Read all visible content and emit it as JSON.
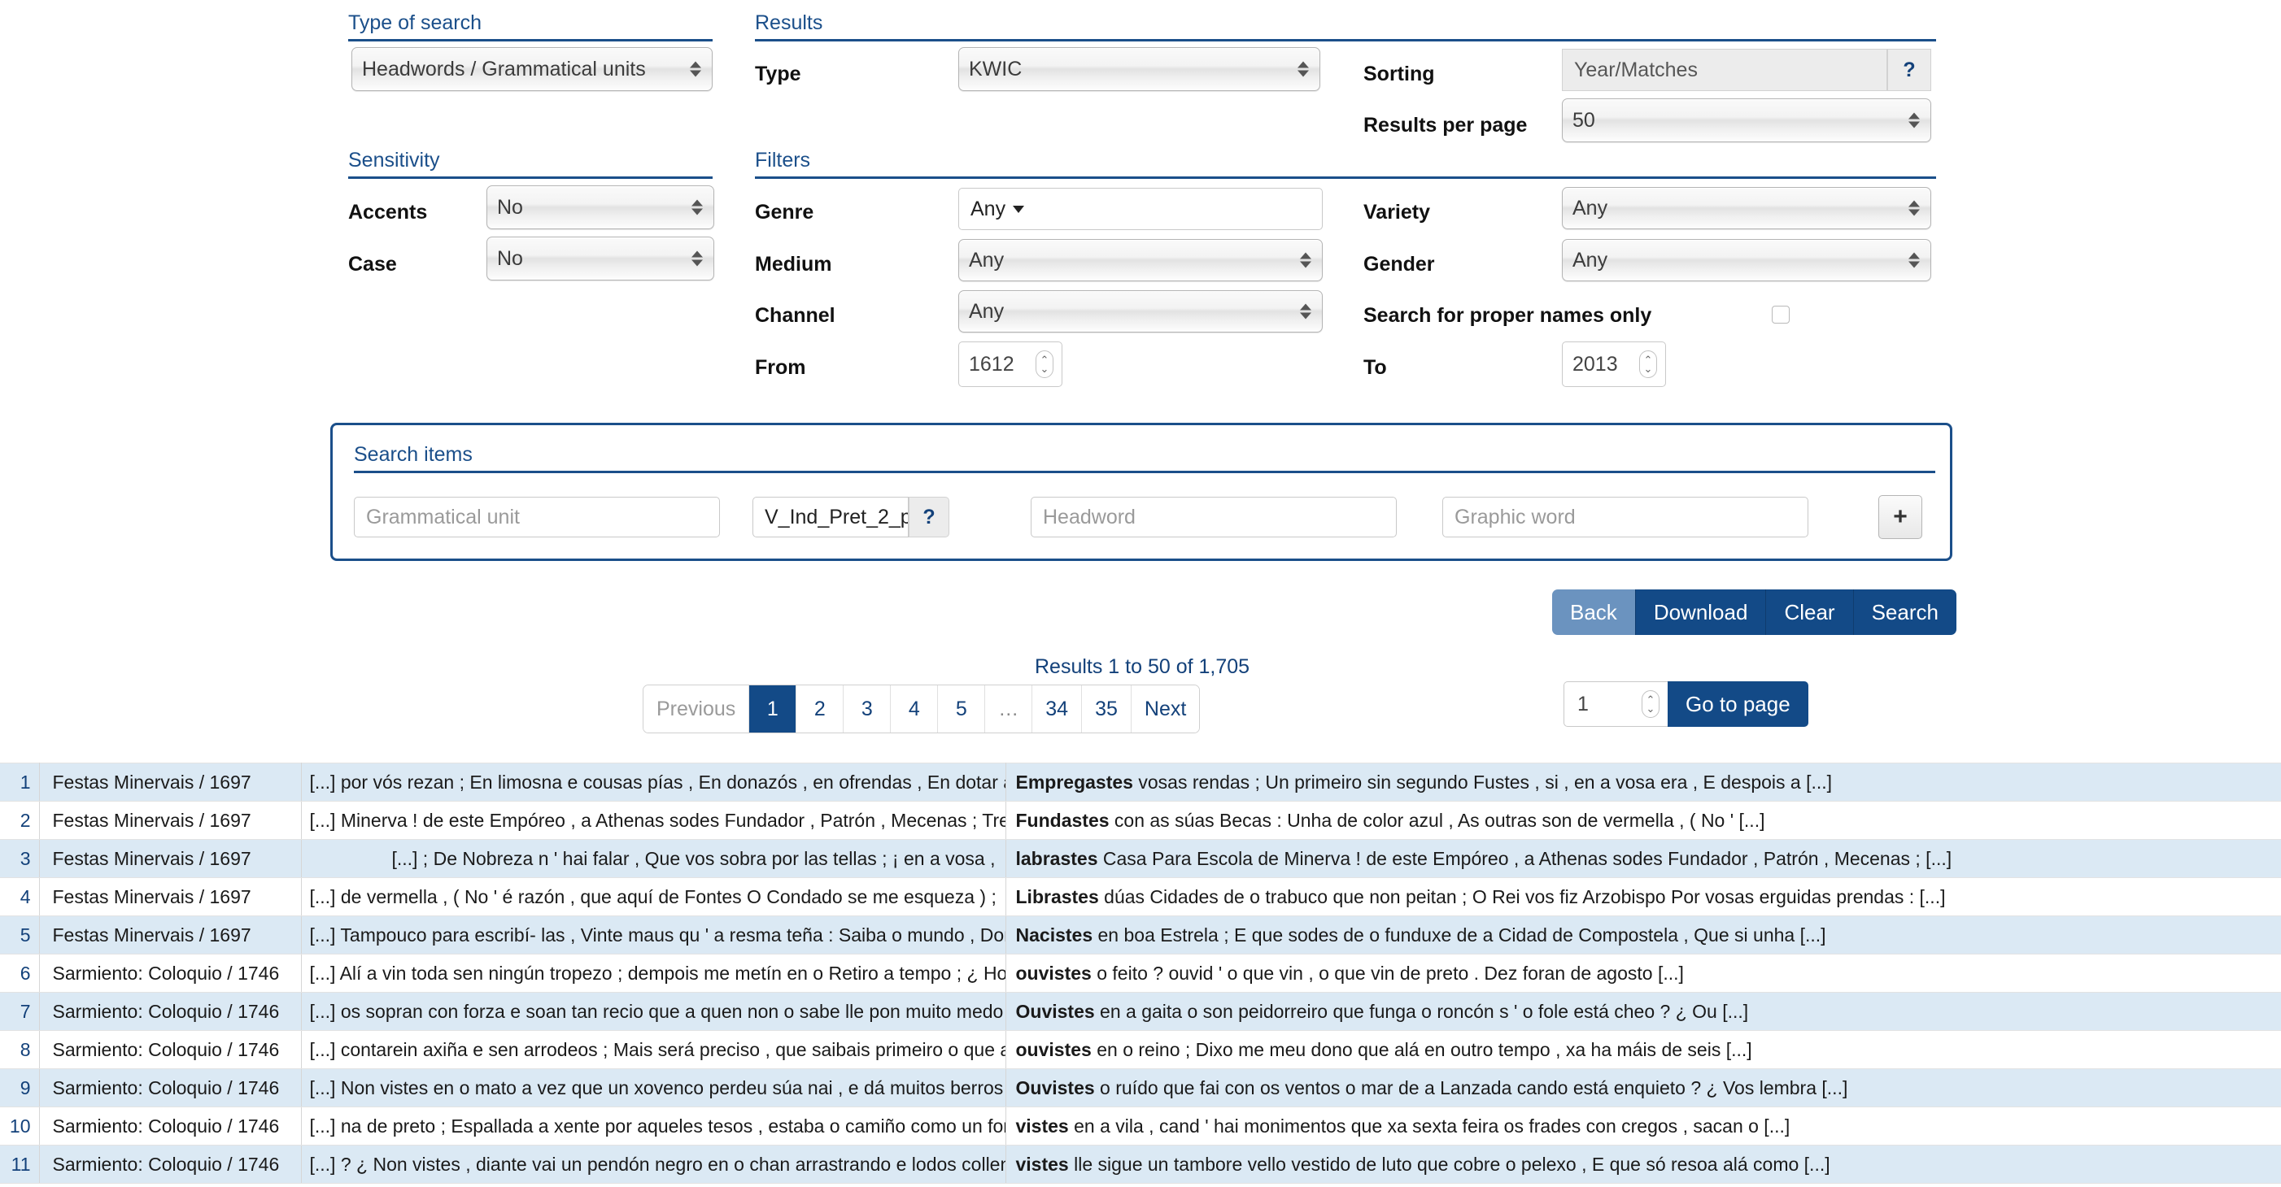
{
  "sections": {
    "type_of_search": "Type of search",
    "results": "Results",
    "sensitivity": "Sensitivity",
    "filters": "Filters",
    "search_items": "Search items"
  },
  "type_of_search": {
    "value": "Headwords / Grammatical units"
  },
  "results_panel": {
    "type_label": "Type",
    "type_value": "KWIC",
    "sorting_label": "Sorting",
    "sorting_value": "Year/Matches",
    "sorting_help": "?",
    "per_page_label": "Results per page",
    "per_page_value": "50"
  },
  "sensitivity": {
    "accents_label": "Accents",
    "accents_value": "No",
    "case_label": "Case",
    "case_value": "No"
  },
  "filters": {
    "genre_label": "Genre",
    "genre_value": "Any",
    "medium_label": "Medium",
    "medium_value": "Any",
    "channel_label": "Channel",
    "channel_value": "Any",
    "from_label": "From",
    "from_value": "1612",
    "to_label": "To",
    "to_value": "2013",
    "variety_label": "Variety",
    "variety_value": "Any",
    "gender_label": "Gender",
    "gender_value": "Any",
    "proper_names_label": "Search for proper names only"
  },
  "search_items": {
    "grammatical_unit_placeholder": "Grammatical unit",
    "tag_value": "V_Ind_Pret_2_p",
    "tag_help": "?",
    "headword_placeholder": "Headword",
    "graphic_word_placeholder": "Graphic word",
    "add_label": "+"
  },
  "actions": {
    "back": "Back",
    "download": "Download",
    "clear": "Clear",
    "search": "Search"
  },
  "pagination": {
    "summary": "Results 1 to 50 of 1,705",
    "previous": "Previous",
    "next": "Next",
    "dots": "…",
    "pages": [
      "1",
      "2",
      "3",
      "4",
      "5"
    ],
    "tail_pages": [
      "34",
      "35"
    ],
    "active_page": "1",
    "goto_value": "1",
    "goto_label": "Go to page"
  },
  "colors": {
    "accent": "#1b4f8a",
    "button": "#134a87",
    "button_muted": "#6b93bf",
    "row_odd": "#dbe9f4",
    "link": "#13417a"
  },
  "results_table": {
    "rows": [
      {
        "num": "1",
        "source": "Festas Minervais / 1697",
        "left": "[...] por vós rezan ; En limosna e cousas pías , En donazós , en ofrendas , En dotar as fundazós",
        "keyword": "Empregastes",
        "right": " vosas rendas ; Un primeiro sin segundo Fustes , si , en a vosa era , E despois a [...]"
      },
      {
        "num": "2",
        "source": "Festas Minervais / 1697",
        "left": "[...] Minerva ! de este Empóreo , a Athenas sodes Fundador , Patrón , Mecenas ; Tres Colexios son os que",
        "keyword": "Fundastes",
        "right": " con as súas Becas : Unha de color azul , As outras son de vermella , ( No ' [...]"
      },
      {
        "num": "3",
        "source": "Festas Minervais / 1697",
        "left": "[...] ; De Nobreza n ' hai falar , Que vos sobra por las tellas ; ¡ en a vosa ,",
        "keyword": "labrastes",
        "right": " Casa Para Escola de Minerva ! de este Empóreo , a Athenas sodes Fundador , Patrón , Mecenas ; [...]"
      },
      {
        "num": "4",
        "source": "Festas Minervais / 1697",
        "left": "[...] de vermella , ( No ' é razón , que aquí de Fontes O Condado se me esqueza ) ;",
        "keyword": "Librastes",
        "right": " dúas Cidades de o trabuco que non peitan ; O Rei vos fiz Arzobispo Por vosas erguidas prendas : [...]"
      },
      {
        "num": "5",
        "source": "Festas Minervais / 1697",
        "left": "[...] Tampouco para escribí- las , Vinte maus qu ' a resma teña : Saiba o mundo , Don Afonso ,",
        "keyword": "Nacistes",
        "right": " en boa Estrela ; E que sodes de o funduxe de a Cidad de Compostela , Que si unha [...]"
      },
      {
        "num": "6",
        "source": "Sarmiento: Coloquio / 1746",
        "left": "[...] Alí a vin toda sen ningún tropezo ; dempois me metín en o Retiro a tempo ; ¿ Homes cachapudos",
        "keyword": "ouvistes",
        "right": " o feito ? ouvid ' o que vin , o que vin de preto . Dez foran de agosto [...]"
      },
      {
        "num": "7",
        "source": "Sarmiento: Coloquio / 1746",
        "left": "[...] os sopran con forza e soan tan recio que a quen non o sabe lle pon muito medo ? ¿",
        "keyword": "Ouvistes",
        "right": " en a gaita o son peidorreiro que funga o roncón s ' o fole está cheo ? ¿ Ou [...]"
      },
      {
        "num": "8",
        "source": "Sarmiento: Coloquio / 1746",
        "left": "[...] contarein axiña e sen arrodeos ; Mais será preciso , que saibais primeiro o que acá , quizabes , xa",
        "keyword": "ouvistes",
        "right": " en o reino ; Dixo me meu dono que alá en outro tempo , xa ha máis de seis [...]"
      },
      {
        "num": "9",
        "source": "Sarmiento: Coloquio / 1746",
        "left": "[...] Non vistes en o mato a vez que un xovenco perdeu súa nai , e dá muitos berros ? ¿",
        "keyword": "Ouvistes",
        "right": " o ruído que fai con os ventos o mar de a Lanzada cando está enquieto ? ¿ Vos lembra [...]"
      },
      {
        "num": "10",
        "source": "Sarmiento: Coloquio / 1746",
        "left": "[...] na de preto ; Espallada a xente por aqueles tesos , estaba o camiño como un formigueiro ; ¿ Non",
        "keyword": "vistes",
        "right": " en a vila , cand ' hai monimentos que xa sexta feira os frades con cregos , sacan o [...]"
      },
      {
        "num": "11",
        "source": "Sarmiento: Coloquio / 1746",
        "left": "[...] ? ¿ Non vistes , diante vai un pendón negro en o chan arrastrando e lodos collendo ? ¿ Non",
        "keyword": "vistes",
        "right": " lle sigue un tambore vello vestido de luto que cobre o pelexo , E que só resoa alá como [...]"
      }
    ]
  }
}
